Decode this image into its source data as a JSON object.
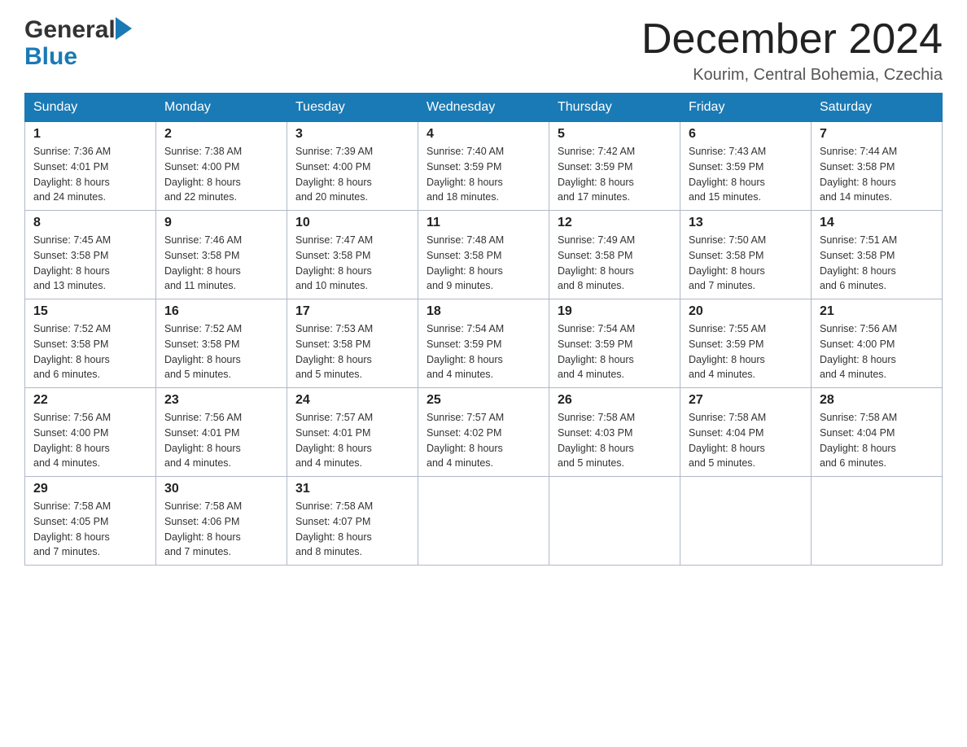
{
  "header": {
    "logo_general": "General",
    "logo_blue": "Blue",
    "month_title": "December 2024",
    "location": "Kourim, Central Bohemia, Czechia"
  },
  "weekdays": [
    "Sunday",
    "Monday",
    "Tuesday",
    "Wednesday",
    "Thursday",
    "Friday",
    "Saturday"
  ],
  "weeks": [
    [
      {
        "day": "1",
        "sunrise": "7:36 AM",
        "sunset": "4:01 PM",
        "daylight": "8 hours and 24 minutes."
      },
      {
        "day": "2",
        "sunrise": "7:38 AM",
        "sunset": "4:00 PM",
        "daylight": "8 hours and 22 minutes."
      },
      {
        "day": "3",
        "sunrise": "7:39 AM",
        "sunset": "4:00 PM",
        "daylight": "8 hours and 20 minutes."
      },
      {
        "day": "4",
        "sunrise": "7:40 AM",
        "sunset": "3:59 PM",
        "daylight": "8 hours and 18 minutes."
      },
      {
        "day": "5",
        "sunrise": "7:42 AM",
        "sunset": "3:59 PM",
        "daylight": "8 hours and 17 minutes."
      },
      {
        "day": "6",
        "sunrise": "7:43 AM",
        "sunset": "3:59 PM",
        "daylight": "8 hours and 15 minutes."
      },
      {
        "day": "7",
        "sunrise": "7:44 AM",
        "sunset": "3:58 PM",
        "daylight": "8 hours and 14 minutes."
      }
    ],
    [
      {
        "day": "8",
        "sunrise": "7:45 AM",
        "sunset": "3:58 PM",
        "daylight": "8 hours and 13 minutes."
      },
      {
        "day": "9",
        "sunrise": "7:46 AM",
        "sunset": "3:58 PM",
        "daylight": "8 hours and 11 minutes."
      },
      {
        "day": "10",
        "sunrise": "7:47 AM",
        "sunset": "3:58 PM",
        "daylight": "8 hours and 10 minutes."
      },
      {
        "day": "11",
        "sunrise": "7:48 AM",
        "sunset": "3:58 PM",
        "daylight": "8 hours and 9 minutes."
      },
      {
        "day": "12",
        "sunrise": "7:49 AM",
        "sunset": "3:58 PM",
        "daylight": "8 hours and 8 minutes."
      },
      {
        "day": "13",
        "sunrise": "7:50 AM",
        "sunset": "3:58 PM",
        "daylight": "8 hours and 7 minutes."
      },
      {
        "day": "14",
        "sunrise": "7:51 AM",
        "sunset": "3:58 PM",
        "daylight": "8 hours and 6 minutes."
      }
    ],
    [
      {
        "day": "15",
        "sunrise": "7:52 AM",
        "sunset": "3:58 PM",
        "daylight": "8 hours and 6 minutes."
      },
      {
        "day": "16",
        "sunrise": "7:52 AM",
        "sunset": "3:58 PM",
        "daylight": "8 hours and 5 minutes."
      },
      {
        "day": "17",
        "sunrise": "7:53 AM",
        "sunset": "3:58 PM",
        "daylight": "8 hours and 5 minutes."
      },
      {
        "day": "18",
        "sunrise": "7:54 AM",
        "sunset": "3:59 PM",
        "daylight": "8 hours and 4 minutes."
      },
      {
        "day": "19",
        "sunrise": "7:54 AM",
        "sunset": "3:59 PM",
        "daylight": "8 hours and 4 minutes."
      },
      {
        "day": "20",
        "sunrise": "7:55 AM",
        "sunset": "3:59 PM",
        "daylight": "8 hours and 4 minutes."
      },
      {
        "day": "21",
        "sunrise": "7:56 AM",
        "sunset": "4:00 PM",
        "daylight": "8 hours and 4 minutes."
      }
    ],
    [
      {
        "day": "22",
        "sunrise": "7:56 AM",
        "sunset": "4:00 PM",
        "daylight": "8 hours and 4 minutes."
      },
      {
        "day": "23",
        "sunrise": "7:56 AM",
        "sunset": "4:01 PM",
        "daylight": "8 hours and 4 minutes."
      },
      {
        "day": "24",
        "sunrise": "7:57 AM",
        "sunset": "4:01 PM",
        "daylight": "8 hours and 4 minutes."
      },
      {
        "day": "25",
        "sunrise": "7:57 AM",
        "sunset": "4:02 PM",
        "daylight": "8 hours and 4 minutes."
      },
      {
        "day": "26",
        "sunrise": "7:58 AM",
        "sunset": "4:03 PM",
        "daylight": "8 hours and 5 minutes."
      },
      {
        "day": "27",
        "sunrise": "7:58 AM",
        "sunset": "4:04 PM",
        "daylight": "8 hours and 5 minutes."
      },
      {
        "day": "28",
        "sunrise": "7:58 AM",
        "sunset": "4:04 PM",
        "daylight": "8 hours and 6 minutes."
      }
    ],
    [
      {
        "day": "29",
        "sunrise": "7:58 AM",
        "sunset": "4:05 PM",
        "daylight": "8 hours and 7 minutes."
      },
      {
        "day": "30",
        "sunrise": "7:58 AM",
        "sunset": "4:06 PM",
        "daylight": "8 hours and 7 minutes."
      },
      {
        "day": "31",
        "sunrise": "7:58 AM",
        "sunset": "4:07 PM",
        "daylight": "8 hours and 8 minutes."
      },
      null,
      null,
      null,
      null
    ]
  ],
  "labels": {
    "sunrise": "Sunrise:",
    "sunset": "Sunset:",
    "daylight": "Daylight:"
  }
}
